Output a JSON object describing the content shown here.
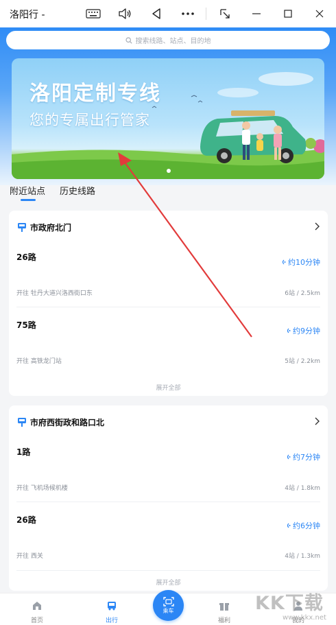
{
  "window": {
    "title": "洛阳行 -"
  },
  "search": {
    "placeholder": "搜索线路、站点、目的地"
  },
  "banner": {
    "title": "洛阳定制专线",
    "subtitle": "您的专属出行管家"
  },
  "tabs": [
    {
      "label": "附近站点",
      "active": true
    },
    {
      "label": "历史线路",
      "active": false
    }
  ],
  "stops": [
    {
      "name": "市政府北门",
      "routes": [
        {
          "route": "26路",
          "eta": "约10分钟",
          "destination": "开往 牡丹大道兴洛西街口东",
          "meta": "6站 / 2.5km"
        },
        {
          "route": "75路",
          "eta": "约9分钟",
          "destination": "开往 高铁龙门站",
          "meta": "5站 / 2.2km"
        }
      ],
      "expand_label": "展开全部"
    },
    {
      "name": "市府西街政和路口北",
      "routes": [
        {
          "route": "1路",
          "eta": "约7分钟",
          "destination": "开往 飞机场候机楼",
          "meta": "4站 / 1.8km"
        },
        {
          "route": "26路",
          "eta": "约6分钟",
          "destination": "开往 西关",
          "meta": "4站 / 1.3km"
        }
      ],
      "expand_label": "展开全部"
    }
  ],
  "bottom_nav": {
    "home": "首页",
    "travel": "出行",
    "ride": "乘车",
    "welfare": "福利",
    "mine": "我的"
  },
  "watermark": {
    "text": "KK下载",
    "url": "www.kkx.net"
  },
  "colors": {
    "accent": "#2b86f5",
    "header_blue": "#2f8cf6"
  }
}
